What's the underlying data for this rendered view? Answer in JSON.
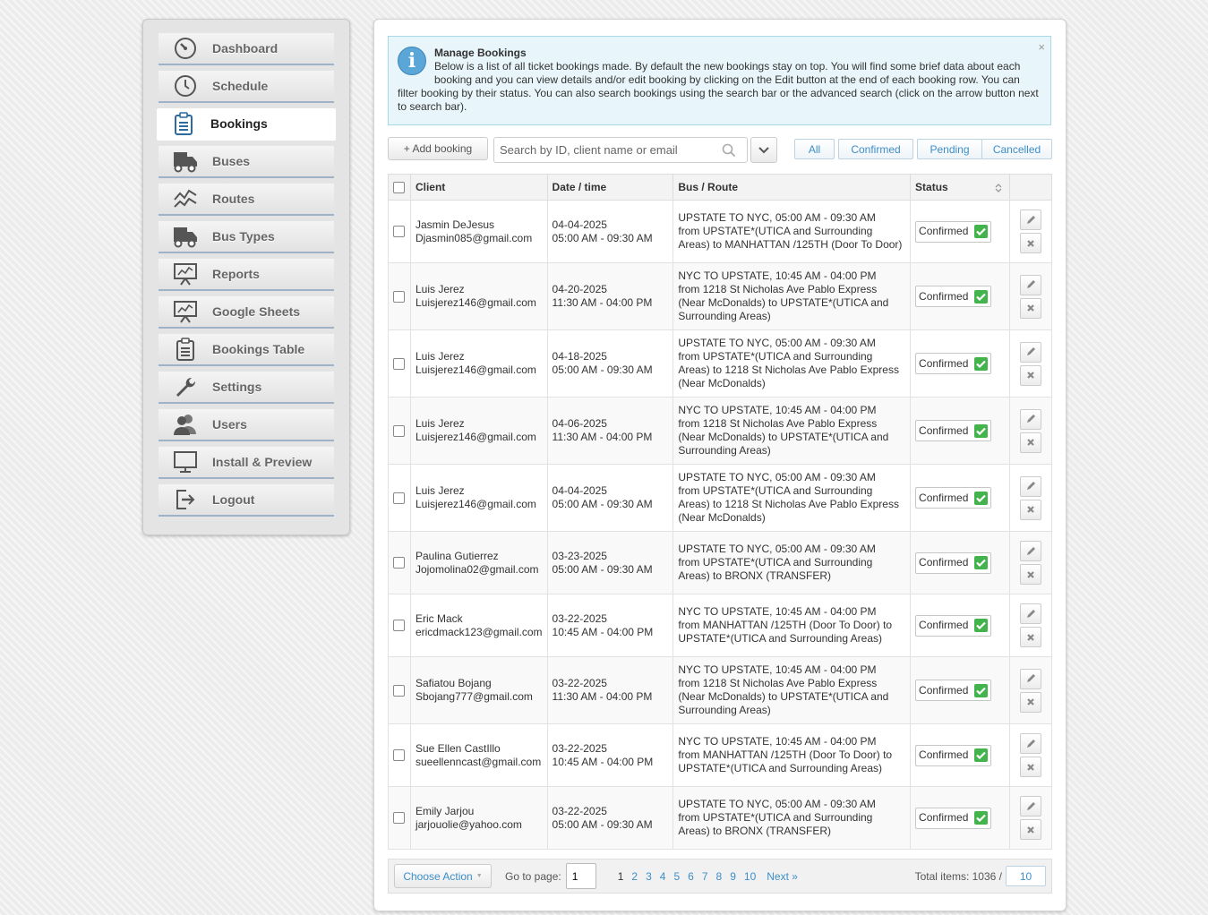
{
  "sidebar": {
    "items": [
      {
        "label": "Dashboard",
        "icon": "dashboard-gauge-icon",
        "active": false
      },
      {
        "label": "Schedule",
        "icon": "clock-icon",
        "active": false
      },
      {
        "label": "Bookings",
        "icon": "clipboard-icon",
        "active": true
      },
      {
        "label": "Buses",
        "icon": "bus-truck-icon",
        "active": false
      },
      {
        "label": "Routes",
        "icon": "route-line-icon",
        "active": false
      },
      {
        "label": "Bus Types",
        "icon": "bus-truck-icon",
        "active": false
      },
      {
        "label": "Reports",
        "icon": "presentation-chart-icon",
        "active": false
      },
      {
        "label": "Google Sheets",
        "icon": "presentation-chart-icon",
        "active": false
      },
      {
        "label": "Bookings Table",
        "icon": "clipboard-icon",
        "active": false
      },
      {
        "label": "Settings",
        "icon": "wrench-icon",
        "active": false
      },
      {
        "label": "Users",
        "icon": "users-icon",
        "active": false
      },
      {
        "label": "Install & Preview",
        "icon": "monitor-icon",
        "active": false
      },
      {
        "label": "Logout",
        "icon": "logout-icon",
        "active": false
      }
    ]
  },
  "notice": {
    "title": "Manage Bookings",
    "text": "Below is a list of all ticket bookings made. By default the new bookings stay on top. You will find some brief data about each booking and you can view details and/or edit booking by clicking on the Edit button at the end of each booking row. You can filter booking by their status. You can also search bookings using the search bar or the advanced search (click on the arrow button next to search bar).",
    "close": "×"
  },
  "toolbar": {
    "add_label": "+ Add booking",
    "search_placeholder": "Search by ID, client name or email",
    "filters": [
      "All",
      "Confirmed",
      "Pending",
      "Cancelled"
    ]
  },
  "table": {
    "headers": {
      "client": "Client",
      "datetime": "Date / time",
      "route": "Bus / Route",
      "status": "Status"
    },
    "rows": [
      {
        "name": "Jasmin DeJesus",
        "email": "Djasmin085@gmail.com",
        "date": "04-04-2025",
        "time": "05:00 AM - 09:30 AM",
        "route_title": "UPSTATE TO NYC, 05:00 AM - 09:30 AM",
        "route_desc": "from UPSTATE*(UTICA and Surrounding Areas) to MANHATTAN /125TH (Door To Door)",
        "status": "Confirmed"
      },
      {
        "name": "Luis Jerez",
        "email": "Luisjerez146@gmail.com",
        "date": "04-20-2025",
        "time": "11:30 AM - 04:00 PM",
        "route_title": "NYC TO UPSTATE, 10:45 AM - 04:00 PM",
        "route_desc": "from 1218 St Nicholas Ave Pablo Express (Near McDonalds) to UPSTATE*(UTICA and Surrounding Areas)",
        "status": "Confirmed"
      },
      {
        "name": "Luis Jerez",
        "email": "Luisjerez146@gmail.com",
        "date": "04-18-2025",
        "time": "05:00 AM - 09:30 AM",
        "route_title": "UPSTATE TO NYC, 05:00 AM - 09:30 AM",
        "route_desc": "from UPSTATE*(UTICA and Surrounding Areas) to 1218 St Nicholas Ave Pablo Express (Near McDonalds)",
        "status": "Confirmed"
      },
      {
        "name": "Luis Jerez",
        "email": "Luisjerez146@gmail.com",
        "date": "04-06-2025",
        "time": "11:30 AM - 04:00 PM",
        "route_title": "NYC TO UPSTATE, 10:45 AM - 04:00 PM",
        "route_desc": "from 1218 St Nicholas Ave Pablo Express (Near McDonalds) to UPSTATE*(UTICA and Surrounding Areas)",
        "status": "Confirmed"
      },
      {
        "name": "Luis Jerez",
        "email": "Luisjerez146@gmail.com",
        "date": "04-04-2025",
        "time": "05:00 AM - 09:30 AM",
        "route_title": "UPSTATE TO NYC, 05:00 AM - 09:30 AM",
        "route_desc": "from UPSTATE*(UTICA and Surrounding Areas) to 1218 St Nicholas Ave Pablo Express (Near McDonalds)",
        "status": "Confirmed"
      },
      {
        "name": "Paulina Gutierrez",
        "email": "Jojomolina02@gmail.com",
        "date": "03-23-2025",
        "time": "05:00 AM - 09:30 AM",
        "route_title": "UPSTATE TO NYC, 05:00 AM - 09:30 AM",
        "route_desc": "from UPSTATE*(UTICA and Surrounding Areas) to BRONX (TRANSFER)",
        "status": "Confirmed"
      },
      {
        "name": "Eric Mack",
        "email": "ericdmack123@gmail.com",
        "date": "03-22-2025",
        "time": "10:45 AM - 04:00 PM",
        "route_title": "NYC TO UPSTATE, 10:45 AM - 04:00 PM",
        "route_desc": "from MANHATTAN /125TH (Door To Door) to UPSTATE*(UTICA and Surrounding Areas)",
        "status": "Confirmed"
      },
      {
        "name": "Safiatou Bojang",
        "email": "Sbojang777@gmail.com",
        "date": "03-22-2025",
        "time": "11:30 AM - 04:00 PM",
        "route_title": "NYC TO UPSTATE, 10:45 AM - 04:00 PM",
        "route_desc": "from 1218 St Nicholas Ave Pablo Express (Near McDonalds) to UPSTATE*(UTICA and Surrounding Areas)",
        "status": "Confirmed"
      },
      {
        "name": "Sue Ellen CastIllo",
        "email": "sueellenncast@gmail.com",
        "date": "03-22-2025",
        "time": "10:45 AM - 04:00 PM",
        "route_title": "NYC TO UPSTATE, 10:45 AM - 04:00 PM",
        "route_desc": "from MANHATTAN /125TH (Door To Door) to UPSTATE*(UTICA and Surrounding Areas)",
        "status": "Confirmed"
      },
      {
        "name": "Emily Jarjou",
        "email": "jarjouolie@yahoo.com",
        "date": "03-22-2025",
        "time": "05:00 AM - 09:30 AM",
        "route_title": "UPSTATE TO NYC, 05:00 AM - 09:30 AM",
        "route_desc": "from UPSTATE*(UTICA and Surrounding Areas) to BRONX (TRANSFER)",
        "status": "Confirmed"
      }
    ]
  },
  "footer": {
    "choose_action": "Choose Action",
    "goto_label": "Go to page:",
    "goto_value": "1",
    "pages": [
      "1",
      "2",
      "3",
      "4",
      "5",
      "6",
      "7",
      "8",
      "9",
      "10"
    ],
    "current_page": "1",
    "next_label": "Next »",
    "total_label": "Total items: 1036 /",
    "per_page": "10"
  },
  "colors": {
    "accent": "#3d8ec9",
    "confirmed": "#43b34b",
    "notice_bg": "#e8f5fa"
  }
}
